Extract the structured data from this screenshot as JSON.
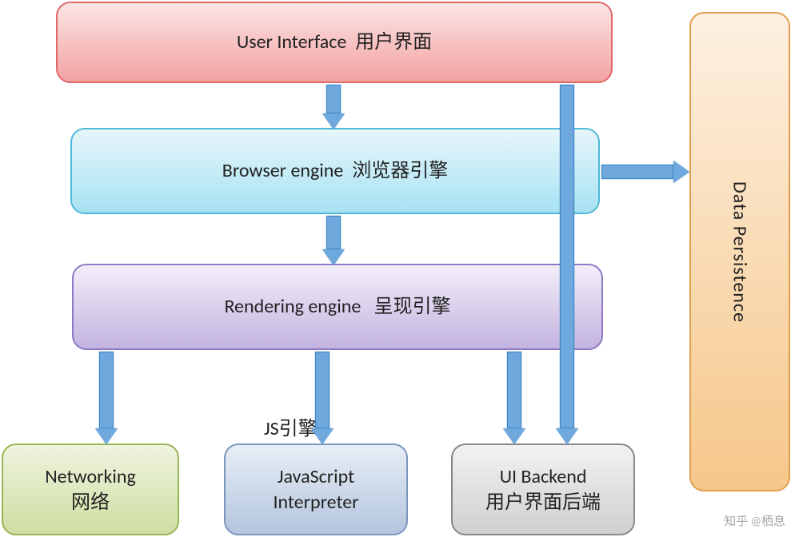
{
  "boxes": {
    "ui": {
      "en": "User  Interface",
      "cn": "用户界面"
    },
    "browser": {
      "en": "Browser engine",
      "cn": "浏览器引擎"
    },
    "rendering": {
      "en": "Rendering engine",
      "cn": "呈现引擎"
    },
    "networking": {
      "en": "Networking",
      "cn": "网络"
    },
    "js": {
      "en": "JavaScript Interpreter",
      "cn_short": "JS引擎"
    },
    "uibackend": {
      "en": "UI Backend",
      "cn": "用户界面后端"
    },
    "persist": {
      "en": "Data Persistence"
    }
  },
  "watermark": "知乎 @栖息"
}
